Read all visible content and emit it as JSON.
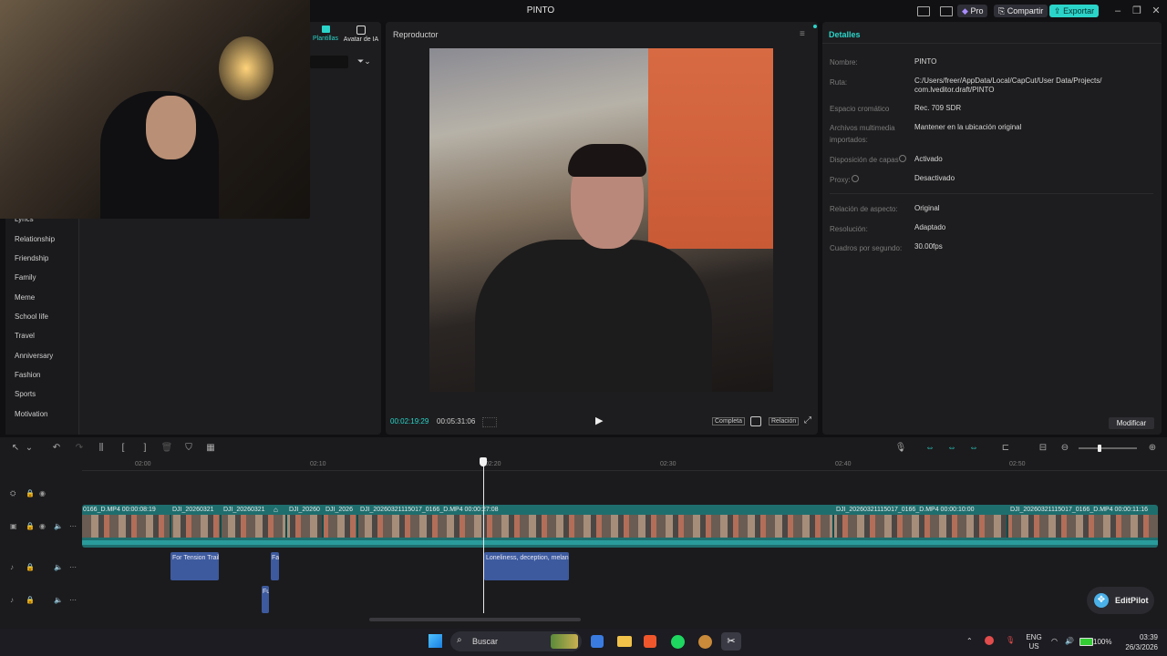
{
  "window": {
    "title": "PINTO",
    "pro_label": "Pro",
    "share_label": "Compartir",
    "export_label": "Exportar",
    "accent": "#2bd4c9"
  },
  "left": {
    "tabs": [
      {
        "label": "Plantillas",
        "icon": "template-icon"
      },
      {
        "label": "Avatar de IA",
        "icon": "ai-avatar-icon"
      }
    ],
    "categories": [
      "Lyrics",
      "Relationship",
      "Friendship",
      "Family",
      "Meme",
      "School life",
      "Travel",
      "Anniversary",
      "Fashion",
      "Sports",
      "Motivation"
    ]
  },
  "player": {
    "title": "Reproductor",
    "current_time": "00:02:19:29",
    "total_time": "00:05:31:06",
    "full_label": "Completa",
    "ratio_label": "Relación"
  },
  "details": {
    "title": "Detalles",
    "fields": [
      {
        "label": "Nombre:",
        "value": "PINTO"
      },
      {
        "label": "Ruta:",
        "value": "C:/Users/freer/AppData/Local/CapCut/User Data/Projects/ com.lveditor.draft/PINTO"
      },
      {
        "label": "Espacio cromático",
        "value": "Rec. 709 SDR"
      },
      {
        "label": "Archivos multimedia importados:",
        "value": "Mantener en la ubicación original"
      },
      {
        "label": "Disposición de capas",
        "value": "Activado"
      },
      {
        "label": "Proxy:",
        "value": "Desactivado"
      },
      {
        "label": "Relación de aspecto:",
        "value": "Original"
      },
      {
        "label": "Resolución:",
        "value": "Adaptado"
      },
      {
        "label": "Cuadros por segundo:",
        "value": "30.00fps"
      }
    ],
    "modify_label": "Modificar"
  },
  "timeline": {
    "ruler_ticks": [
      "02:00",
      "02:10",
      "02:20",
      "02:30",
      "02:40",
      "02:50"
    ],
    "video_clips": [
      "0166_D.MP4   00:00:08:19",
      "DJI_20260321",
      "DJI_20260321",
      "DJI_20260",
      "DJI_2026",
      "DJI_20260321115017_0166_D.MP4   00:00:27:08",
      "DJI_20260321115017_0166_D.MP4   00:00:10:00",
      "DJI_20260321115017_0166_D.MP4   00:00:11:16"
    ],
    "audio_clips": [
      "For Tension Trailer",
      "Fa",
      "Loneliness, deception, melan",
      "Fu"
    ]
  },
  "editpilot_label": "EditPilot",
  "taskbar": {
    "search_placeholder": "Buscar",
    "lang": "ENG",
    "region": "US",
    "battery": "100%",
    "time": "03:39",
    "date": "26/3/2026"
  }
}
